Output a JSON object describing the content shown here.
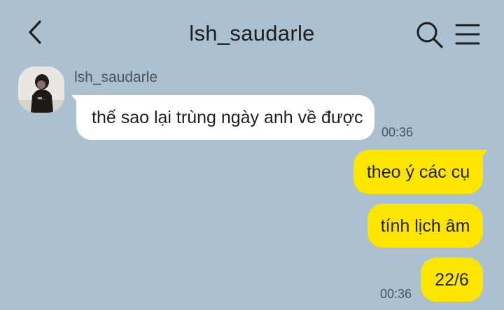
{
  "header": {
    "title": "lsh_saudarle",
    "back_icon": "chevron-left-icon",
    "search_icon": "search-icon",
    "menu_icon": "hamburger-menu-icon"
  },
  "colors": {
    "background": "#abc1d1",
    "incoming_bubble": "#ffffff",
    "outgoing_bubble": "#fee500",
    "timestamp": "#4b535b"
  },
  "messages": {
    "incoming": {
      "sender": "lsh_saudarle",
      "text": "thế sao lại trùng ngày anh về được",
      "time": "00:36"
    },
    "outgoing": [
      {
        "text": "theo ý các cụ"
      },
      {
        "text": "tính lịch âm"
      },
      {
        "text": "22/6"
      }
    ],
    "outgoing_time": "00:36"
  }
}
